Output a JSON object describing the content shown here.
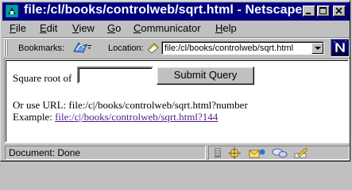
{
  "window": {
    "title": "file:/cl/books/controlweb/sqrt.html - Netscape"
  },
  "menu": {
    "items": [
      {
        "label": "File",
        "accel": "F",
        "rest": "ile"
      },
      {
        "label": "Edit",
        "accel": "E",
        "rest": "dit"
      },
      {
        "label": "View",
        "accel": "V",
        "rest": "iew"
      },
      {
        "label": "Go",
        "accel": "G",
        "rest": "o"
      },
      {
        "label": "Communicator",
        "accel": "C",
        "rest": "ommunicator"
      },
      {
        "label": "Help",
        "accel": "H",
        "rest": "elp"
      }
    ]
  },
  "location_bar": {
    "bookmarks_label": "Bookmarks:",
    "location_label": "Location:",
    "url": "file:/cl/books/controlweb/sqrt.html"
  },
  "page": {
    "square_root_label": "Square root of",
    "input_value": "",
    "submit_label": "Submit Query",
    "url_hint": "Or use URL: file:/c|/books/controlweb/sqrt.html?number",
    "example_label": "Example:",
    "example_link": "file:/c|/books/controlweb/sqrt.html?144"
  },
  "status": {
    "text": "Document: Done"
  },
  "colors": {
    "titlebar": "#000080",
    "chrome": "#c0c0c0",
    "visited_link": "#551a8b"
  },
  "icons": {
    "app": "netscape-window-icon",
    "bookmarks": "bookmark-icon",
    "location": "page-location-icon",
    "logo": "netscape-n-logo",
    "status": [
      "security-lock-icon",
      "navigator-icon",
      "mail-icon",
      "discussion-icon",
      "composer-icon"
    ]
  }
}
